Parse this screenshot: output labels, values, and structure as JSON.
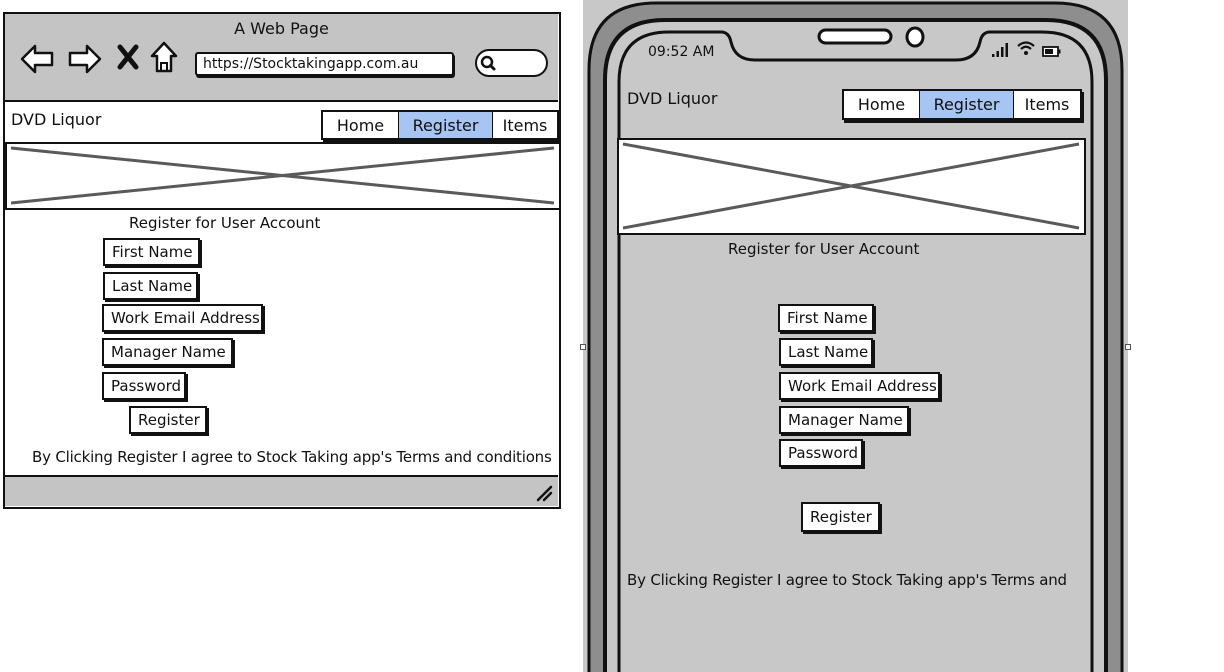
{
  "browser": {
    "title": "A Web Page",
    "url": "https://Stocktakingapp.com.au",
    "icons": [
      "back-arrow-icon",
      "forward-arrow-icon",
      "close-icon",
      "home-icon",
      "search-icon",
      "resize-grip-icon"
    ]
  },
  "desktop": {
    "brand": "DVD Liquor",
    "nav": [
      {
        "label": "Home",
        "active": false
      },
      {
        "label": "Register",
        "active": true
      },
      {
        "label": "Items",
        "active": false
      }
    ],
    "heading": "Register for User Account",
    "fields": [
      "First Name",
      "Last Name",
      "Work Email Address",
      "Manager Name",
      "Password"
    ],
    "submit_label": "Register",
    "terms": "By Clicking Register I agree to Stock Taking app's Terms and conditions"
  },
  "mobile": {
    "time": "09:52 AM",
    "status_icons": [
      "signal-icon",
      "wifi-icon",
      "battery-icon"
    ],
    "brand": "DVD Liquor",
    "nav": [
      {
        "label": "Home",
        "active": false
      },
      {
        "label": "Register",
        "active": true
      },
      {
        "label": "Items",
        "active": false
      }
    ],
    "heading": "Register for User Account",
    "fields": [
      "First Name",
      "Last Name",
      "Work Email Address",
      "Manager Name",
      "Password"
    ],
    "submit_label": "Register",
    "terms": "By Clicking Register I agree to Stock Taking app's Terms and"
  },
  "colors": {
    "active_tab": "#a7c5f2",
    "chrome_gray": "#c4c4c4",
    "phone_screen": "#c8c8c8",
    "phone_body": "#8a8a8a"
  }
}
